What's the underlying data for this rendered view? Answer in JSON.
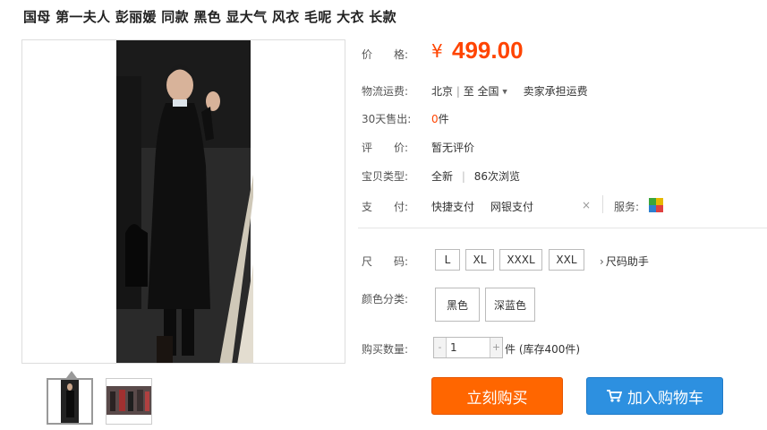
{
  "title": "国母 第一夫人 彭丽媛 同款 黑色 显大气 风衣 毛呢 大衣 长款",
  "price": {
    "label": "价　　格:",
    "currency": "¥",
    "amount": "499.00"
  },
  "shipping": {
    "label": "物流运费:",
    "from": "北京",
    "to_prefix": "至",
    "to": "全国",
    "dropdown": "▼",
    "note": "卖家承担运费"
  },
  "sold30": {
    "label": "30天售出:",
    "count": "0",
    "unit": "件"
  },
  "review": {
    "label": "评　　价:",
    "value": "暂无评价"
  },
  "item_type": {
    "label": "宝贝类型:",
    "condition": "全新",
    "views": "86次浏览"
  },
  "payment": {
    "label": "支　　付:",
    "methods": [
      "快捷支付",
      "网银支付"
    ],
    "close": "×"
  },
  "service": {
    "label": "服务:"
  },
  "sizes": {
    "label": "尺　　码:",
    "options": [
      "L",
      "XL",
      "XXXL",
      "XXL"
    ],
    "helper": "尺码助手",
    "helper_arrow": "›"
  },
  "colors": {
    "label": "颜色分类:",
    "options": [
      "黑色",
      "深蓝色"
    ]
  },
  "quantity": {
    "label": "购买数量:",
    "value": "1",
    "minus": "-",
    "plus": "+",
    "unit_stock": "件 (库存400件)"
  },
  "actions": {
    "buy_now": "立刻购买",
    "add_to_cart": "加入购物车",
    "cart_icon": "shopping-cart-icon"
  },
  "colors_theme": {
    "price": "#ff4400",
    "buy": "#ff6600",
    "cart": "#2d90e0"
  }
}
